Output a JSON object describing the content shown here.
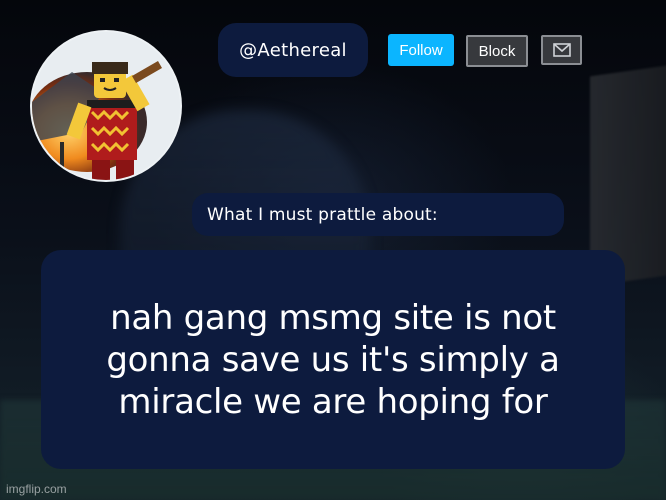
{
  "profile": {
    "username": "@Aethereal"
  },
  "actions": {
    "follow_label": "Follow",
    "block_label": "Block",
    "message_icon": "mail-icon"
  },
  "prattle": {
    "heading": "What I must prattle about:"
  },
  "post": {
    "body": "nah gang msmg site is not gonna save us it's simply a miracle we are hoping for"
  },
  "watermark": "imgflip.com",
  "colors": {
    "pill_bg": "#0d1b3e",
    "follow_bg": "#0bb5ff",
    "block_bg": "#37393d"
  }
}
